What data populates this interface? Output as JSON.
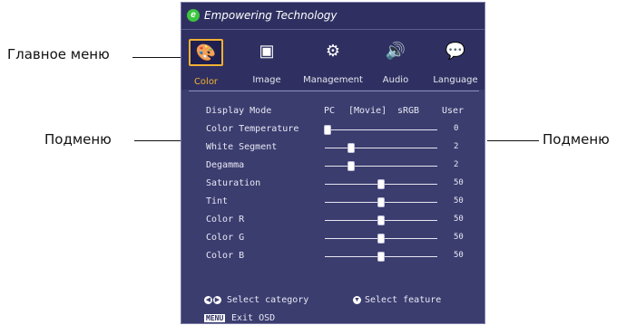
{
  "callouts": {
    "main_menu": "Главное меню",
    "submenu_left": "Подменю",
    "submenu_right": "Подменю"
  },
  "osd": {
    "brand": "Empowering Technology",
    "tabs": [
      {
        "label": "Color",
        "icon": "color-icon",
        "selected": true
      },
      {
        "label": "Image",
        "icon": "image-icon",
        "selected": false
      },
      {
        "label": "Management",
        "icon": "management-icon",
        "selected": false
      },
      {
        "label": "Audio",
        "icon": "audio-icon",
        "selected": false
      },
      {
        "label": "Language",
        "icon": "language-icon",
        "selected": false
      }
    ],
    "display_mode": {
      "label": "Display Mode",
      "options": [
        "PC",
        "[Movie]",
        "sRGB",
        "User"
      ]
    },
    "rows": [
      {
        "label": "Color Temperature",
        "value": "0",
        "level": 0.0
      },
      {
        "label": "White Segment",
        "value": "2",
        "level": 0.22
      },
      {
        "label": "Degamma",
        "value": "2",
        "level": 0.22
      },
      {
        "label": "Saturation",
        "value": "50",
        "level": 0.5
      },
      {
        "label": "Tint",
        "value": "50",
        "level": 0.5
      },
      {
        "label": "Color R",
        "value": "50",
        "level": 0.5
      },
      {
        "label": "Color G",
        "value": "50",
        "level": 0.5
      },
      {
        "label": "Color B",
        "value": "50",
        "level": 0.5
      }
    ],
    "footer": {
      "select_category": "Select category",
      "select_feature": "Select feature",
      "menu_key": "MENU",
      "exit": "Exit OSD"
    }
  },
  "colors": {
    "osd_bg": "#3b3d6f",
    "header_bg": "#2f3061",
    "highlight": "#f2b134"
  }
}
